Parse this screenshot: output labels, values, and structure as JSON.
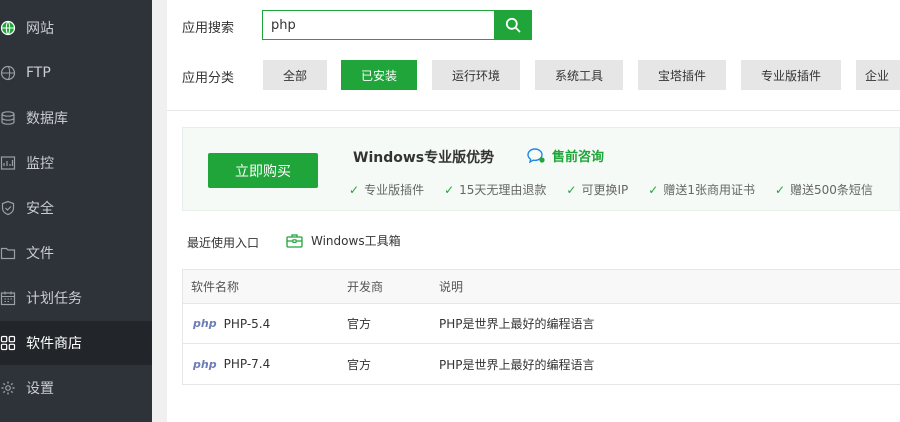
{
  "sidebar": {
    "items": [
      {
        "label": "网站",
        "icon": "globe-icon",
        "active": false
      },
      {
        "label": "FTP",
        "icon": "ftp-icon",
        "active": false
      },
      {
        "label": "数据库",
        "icon": "database-icon",
        "active": false
      },
      {
        "label": "监控",
        "icon": "monitor-icon",
        "active": false
      },
      {
        "label": "安全",
        "icon": "shield-icon",
        "active": false
      },
      {
        "label": "文件",
        "icon": "folder-icon",
        "active": false
      },
      {
        "label": "计划任务",
        "icon": "calendar-icon",
        "active": false
      },
      {
        "label": "软件商店",
        "icon": "grid-icon",
        "active": true
      },
      {
        "label": "设置",
        "icon": "gear-icon",
        "active": false
      }
    ]
  },
  "search": {
    "label": "应用搜索",
    "value": "php",
    "button_icon": "search-icon"
  },
  "category": {
    "label": "应用分类",
    "items": [
      "全部",
      "已安装",
      "运行环境",
      "系统工具",
      "宝塔插件",
      "专业版插件",
      "企业"
    ],
    "active": "已安装"
  },
  "promo": {
    "buy_label": "立即购买",
    "title": "Windows专业版优势",
    "consult_label": "售前咨询",
    "features": [
      "专业版插件",
      "15天无理由退款",
      "可更换IP",
      "赠送1张商用证书",
      "赠送500条短信"
    ]
  },
  "recent": {
    "label": "最近使用入口",
    "toolbox_label": "Windows工具箱"
  },
  "table": {
    "headers": [
      "软件名称",
      "开发商",
      "说明"
    ],
    "rows": [
      {
        "logo": "php",
        "name": "PHP-5.4",
        "vendor": "官方",
        "desc": "PHP是世界上最好的编程语言"
      },
      {
        "logo": "php",
        "name": "PHP-7.4",
        "vendor": "官方",
        "desc": "PHP是世界上最好的编程语言"
      }
    ]
  },
  "colors": {
    "accent": "#20a53a",
    "sidebar_bg": "#2e3339",
    "sidebar_active_bg": "#22262a"
  }
}
